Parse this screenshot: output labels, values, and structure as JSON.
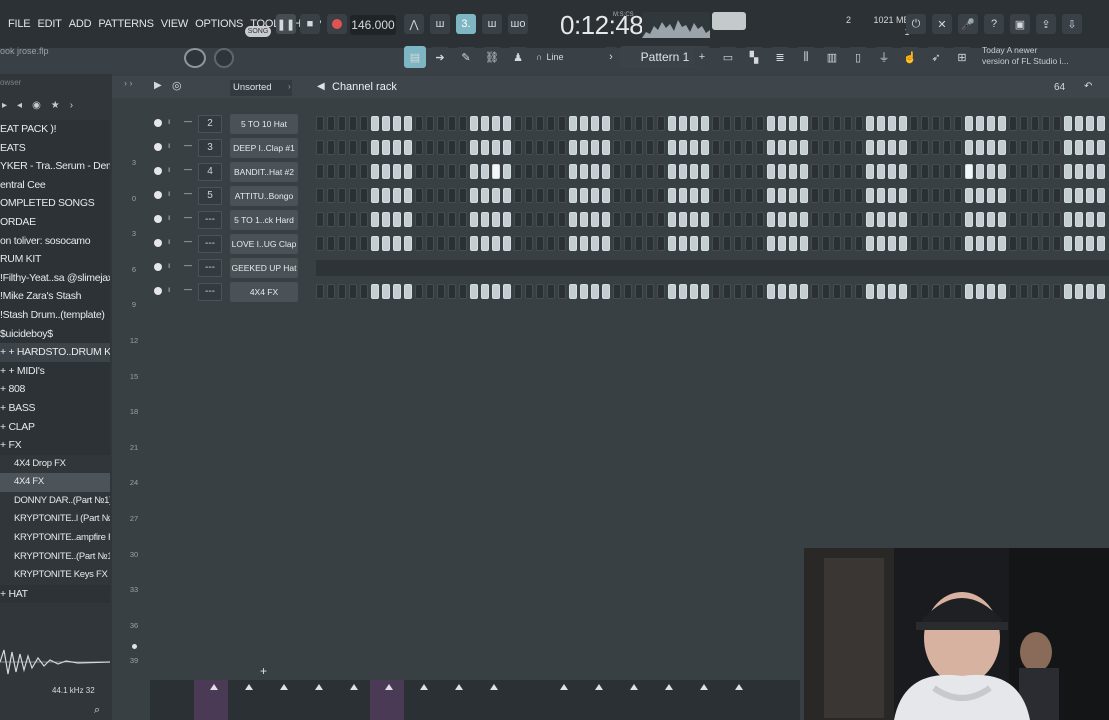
{
  "menu": [
    "FILE",
    "EDIT",
    "ADD",
    "PATTERNS",
    "VIEW",
    "OPTIONS",
    "TOOLS",
    "HELP"
  ],
  "file_name": "ook jrose.flp",
  "song_toggle": "SONG",
  "tempo": "146.000",
  "time": "0:12:48",
  "time_unit": "M:S:CS",
  "memory": "1021 MB",
  "voices": "2",
  "voices_sub": "1",
  "pattern": "Pattern 1",
  "line_mode": "Line",
  "hint": {
    "line1": "Today  A newer",
    "line2": "version of FL Studio i..."
  },
  "browser": {
    "title": "owser",
    "items": [
      {
        "label": "EAT PACK )!",
        "kind": "folder"
      },
      {
        "label": "EATS",
        "kind": "folder"
      },
      {
        "label": "YKER - Tra..Serum - Demo",
        "kind": "folder"
      },
      {
        "label": "entral Cee",
        "kind": "folder"
      },
      {
        "label": "OMPLETED SONGS",
        "kind": "folder"
      },
      {
        "label": "ORDAE",
        "kind": "folder"
      },
      {
        "label": "on toliver: sosocamo",
        "kind": "folder"
      },
      {
        "label": "RUM KIT",
        "kind": "folder"
      },
      {
        "label": " !Filthy-Yeat..sa @slimejax",
        "kind": "folder"
      },
      {
        "label": " !Mike Zara's Stash",
        "kind": "folder"
      },
      {
        "label": " !Stash Drum..(template)",
        "kind": "folder"
      },
      {
        "label": " $uicideboy$",
        "kind": "folder"
      },
      {
        "label": "+ + HARDSTO..DRUM KIT",
        "kind": "open"
      },
      {
        "label": "+ + MIDI's",
        "kind": "folder"
      },
      {
        "label": "+ 808",
        "kind": "folder"
      },
      {
        "label": "+ BASS",
        "kind": "folder"
      },
      {
        "label": "+ CLAP",
        "kind": "folder"
      },
      {
        "label": "+ FX",
        "kind": "folder"
      },
      {
        "label": "4X4 Drop FX",
        "kind": "sub"
      },
      {
        "label": "4X4 FX",
        "kind": "sub sel"
      },
      {
        "label": "DONNY DAR..(Part №1)",
        "kind": "sub"
      },
      {
        "label": "KRYPTONITE..l (Part №2)",
        "kind": "sub"
      },
      {
        "label": "KRYPTONITE..ampfire FX",
        "kind": "sub"
      },
      {
        "label": "KRYPTONITE..(Part №1)",
        "kind": "sub"
      },
      {
        "label": "KRYPTONITE Keys FX",
        "kind": "sub"
      },
      {
        "label": "+ HAT",
        "kind": "folder"
      }
    ],
    "sample_rate": "44.1 kHz 32"
  },
  "rack": {
    "filter": "Unsorted",
    "title": "Channel rack",
    "swing": "64",
    "ruler": [
      "3",
      "0",
      "3",
      "6",
      "9",
      "12",
      "15",
      "18",
      "21",
      "24",
      "27",
      "30",
      "33",
      "36",
      "39"
    ],
    "channels": [
      {
        "num": "2",
        "name": "5 TO 10 Hat",
        "type": "steps"
      },
      {
        "num": "3",
        "name": "DEEP I..Clap #1",
        "type": "steps"
      },
      {
        "num": "4",
        "name": "BANDIT..Hat #2",
        "type": "steps"
      },
      {
        "num": "5",
        "name": "ATTITU..Bongo",
        "type": "steps"
      },
      {
        "num": "---",
        "name": "5 TO 1..ck Hard",
        "type": "steps"
      },
      {
        "num": "---",
        "name": "LOVE I..UG Clap",
        "type": "steps"
      },
      {
        "num": "---",
        "name": "GEEKED UP Hat",
        "type": "piano"
      },
      {
        "num": "---",
        "name": "4X4 FX",
        "type": "steps"
      }
    ]
  }
}
